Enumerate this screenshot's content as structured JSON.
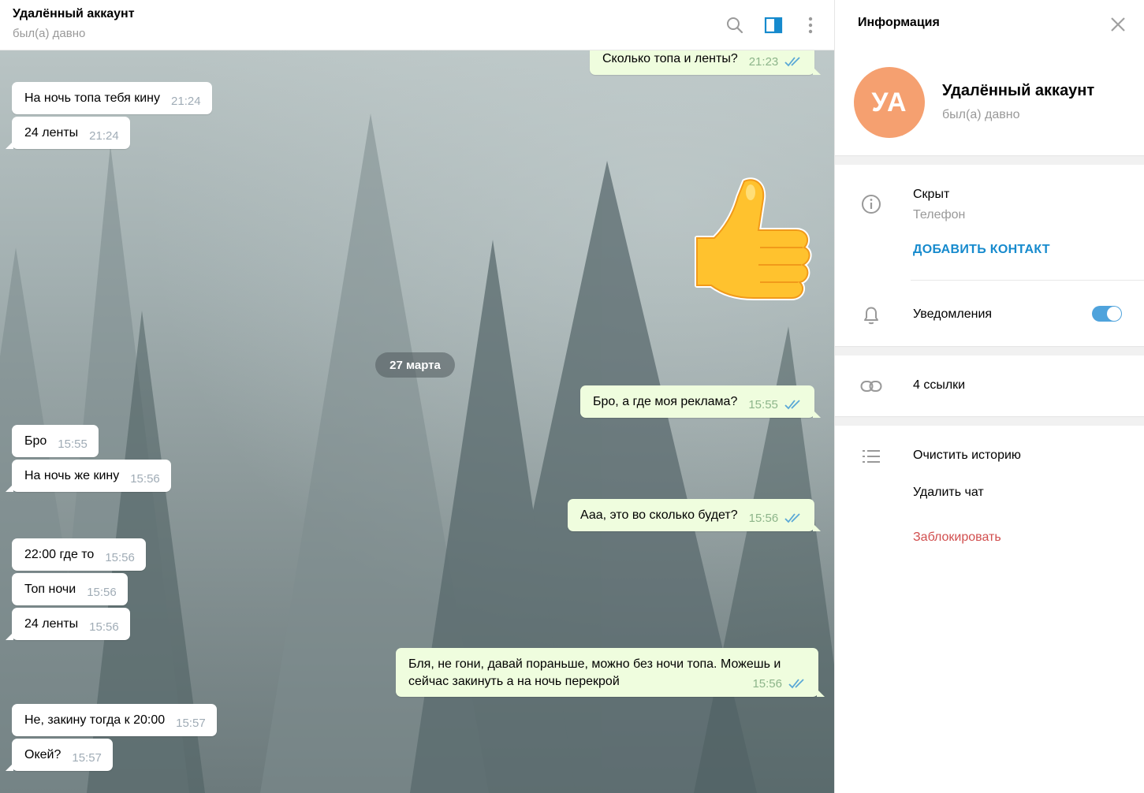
{
  "header": {
    "title": "Удалённый аккаунт",
    "status": "был(а) давно",
    "icons": [
      "search-icon",
      "sidebar-toggle-icon",
      "more-vertical-icon"
    ]
  },
  "date_separator": "27 марта",
  "messages": [
    {
      "dir": "out",
      "text": "Сколько топа и ленты?",
      "time": "21:23",
      "read": true
    },
    {
      "dir": "in",
      "text": "На ночь топа тебя кину",
      "time": "21:24"
    },
    {
      "dir": "in",
      "text": "24 ленты",
      "time": "21:24"
    },
    {
      "dir": "out",
      "sticker": "thumbs-up",
      "time": ""
    },
    {
      "dir": "out",
      "text": "Бро, а где моя реклама?",
      "time": "15:55",
      "read": true
    },
    {
      "dir": "in",
      "text": "Бро",
      "time": "15:55"
    },
    {
      "dir": "in",
      "text": "На ночь же кину",
      "time": "15:56"
    },
    {
      "dir": "out",
      "text": "Ааа, это во сколько будет?",
      "time": "15:56",
      "read": true
    },
    {
      "dir": "in",
      "text": "22:00 где то",
      "time": "15:56"
    },
    {
      "dir": "in",
      "text": "Топ ночи",
      "time": "15:56"
    },
    {
      "dir": "in",
      "text": "24 ленты",
      "time": "15:56"
    },
    {
      "dir": "out",
      "text": "Бля, не гони, давай пораньше, можно без ночи топа. Можешь и сейчас закинуть а на ночь перекрой",
      "time": "15:56",
      "read": true
    },
    {
      "dir": "in",
      "text": "Не, закину тогда к 20:00",
      "time": "15:57"
    },
    {
      "dir": "in",
      "text": "Окей?",
      "time": "15:57"
    }
  ],
  "info_panel": {
    "title": "Информация",
    "avatar_initials": "УА",
    "avatar_color": "#f5a070",
    "name": "Удалённый аккаунт",
    "status": "был(а) давно",
    "phone_value": "Скрыт",
    "phone_label": "Телефон",
    "add_contact": "ДОБАВИТЬ КОНТАКТ",
    "notifications_label": "Уведомления",
    "notifications_on": true,
    "links_label": "4 ссылки",
    "clear_history": "Очистить историю",
    "delete_chat": "Удалить чат",
    "block": "Заблокировать"
  },
  "colors": {
    "accent": "#168acd",
    "outgoing_bubble": "#effdde",
    "danger": "#d14e4e",
    "toggle": "#4fa3dc"
  }
}
